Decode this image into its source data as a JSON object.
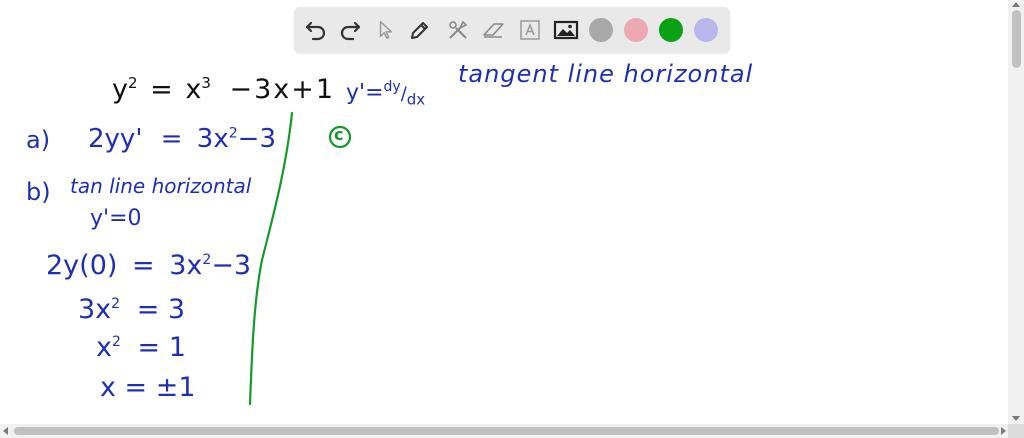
{
  "toolbar": {
    "tools": [
      {
        "name": "undo-icon"
      },
      {
        "name": "redo-icon"
      },
      {
        "name": "select-icon"
      },
      {
        "name": "pen-icon"
      },
      {
        "name": "tools-icon"
      },
      {
        "name": "eraser-icon"
      },
      {
        "name": "text-icon"
      },
      {
        "name": "image-icon"
      }
    ],
    "colors": [
      "#a8a8a8",
      "#eda9b1",
      "#0aa215",
      "#b9b6ee"
    ]
  },
  "board": {
    "equation": {
      "lhs": "y",
      "lhs_exp": "2",
      "eq": "=",
      "x": "x",
      "x_exp": "3",
      "rest": "−3x+1"
    },
    "derivative_note": {
      "prefix": "y'=",
      "num": "dy",
      "den": "dx"
    },
    "heading": "tangent line horizontal",
    "part_a": {
      "label": "a)",
      "expr": "2yy'",
      "eq": "=",
      "rhs": "3x",
      "rhs_exp": "2",
      "rhs_tail": "−3"
    },
    "part_b": {
      "label": "b)",
      "text": "tan line horizontal"
    },
    "b_line1": "y'=0",
    "b_line2": {
      "lhs": "2y(0)",
      "eq": "=",
      "rhs": "3x",
      "exp": "2",
      "tail": "−3"
    },
    "b_line3": {
      "lhs": "3x",
      "exp": "2",
      "rest": "= 3"
    },
    "b_line4": {
      "lhs": "x",
      "exp": "2",
      "rest": "= 1"
    },
    "b_line5": "x = ±1",
    "part_c": "c"
  }
}
